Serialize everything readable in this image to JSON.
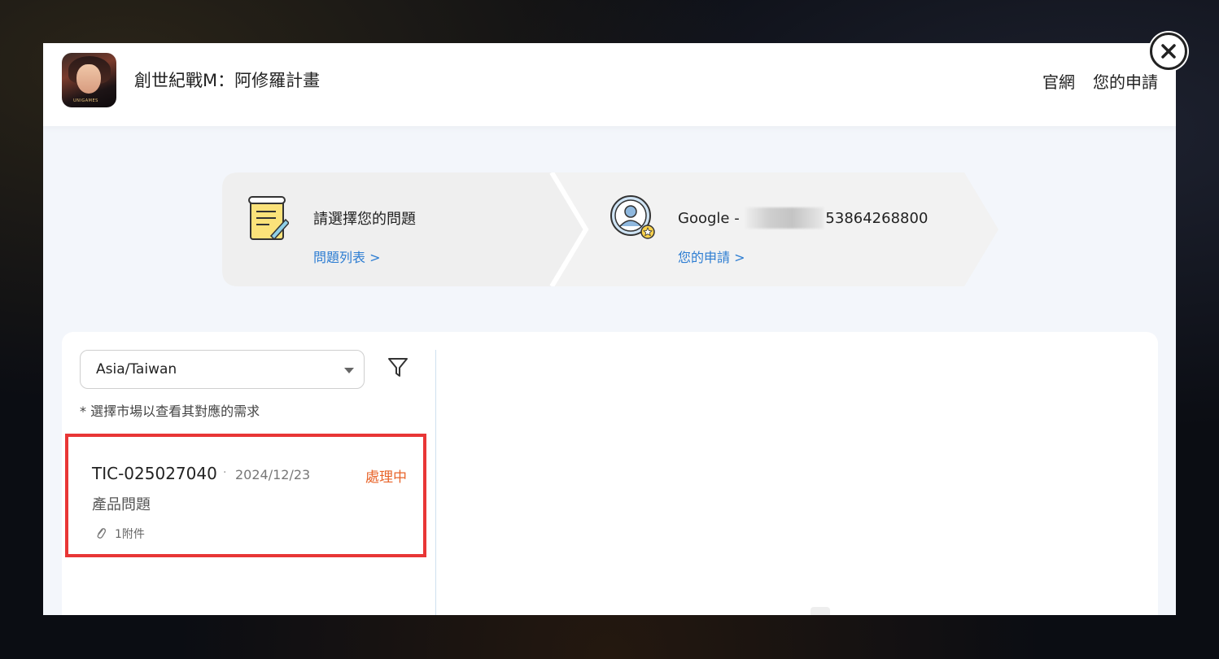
{
  "header": {
    "app_title": "創世紀戰M：阿修羅計畫",
    "icon_tag": "UNIGAMES",
    "nav": [
      "官網",
      "您的申請"
    ]
  },
  "steps": {
    "step1": {
      "title": "請選擇您的問題",
      "link": "問題列表 >"
    },
    "step2": {
      "title_prefix": "Google - ",
      "title_suffix": "53864268800",
      "link": "您的申請 >"
    }
  },
  "filter": {
    "region_value": "Asia/Taiwan",
    "hint": "* 選擇市場以查看其對應的需求"
  },
  "tickets": [
    {
      "id": "TIC-025027040",
      "separator": "·",
      "date": "2024/12/23",
      "status": "處理中",
      "category": "產品問題",
      "attachments": "1附件"
    }
  ],
  "colors": {
    "link": "#2d7dd2",
    "status": "#e8642a",
    "highlight": "#e83636"
  }
}
